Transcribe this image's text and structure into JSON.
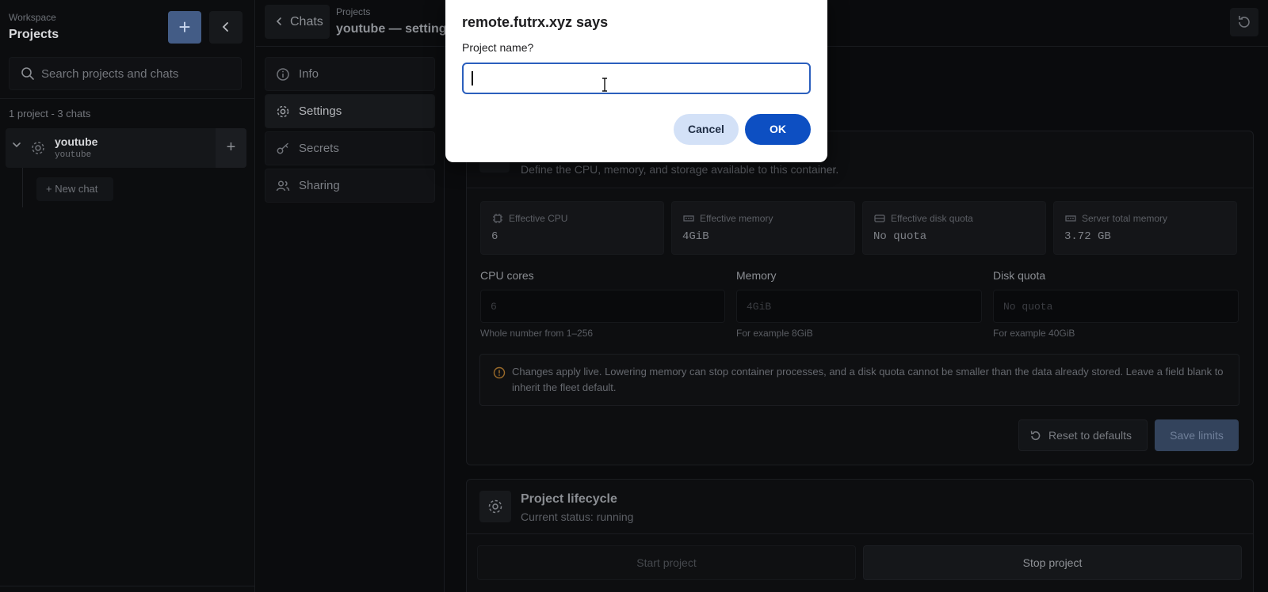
{
  "sidebar": {
    "kicker": "Workspace",
    "title": "Projects",
    "new_button_glyph": "+",
    "collapse_glyph": "‹",
    "search_placeholder": "Search projects and chats",
    "count": "1 project - 3 chats",
    "projects": [
      {
        "name": "youtube",
        "slug": "youtube",
        "add_glyph": "+"
      }
    ],
    "new_chat_label": "+  New chat"
  },
  "breadcrumb": {
    "back_label": "Chats",
    "kicker": "Projects",
    "title": "youtube — settings"
  },
  "nav": {
    "items": [
      {
        "label": "Info",
        "icon": "info-icon"
      },
      {
        "label": "Settings",
        "icon": "gear-icon",
        "active": true
      },
      {
        "label": "Secrets",
        "icon": "key-icon"
      },
      {
        "label": "Sharing",
        "icon": "users-icon"
      }
    ]
  },
  "limits": {
    "subtitle": "Define the CPU, memory, and storage available to this container.",
    "stats": [
      {
        "label": "Effective CPU",
        "value": "6",
        "icon": "cpu-icon"
      },
      {
        "label": "Effective memory",
        "value": "4GiB",
        "icon": "memory-icon"
      },
      {
        "label": "Effective disk quota",
        "value": "No quota",
        "icon": "disk-icon"
      },
      {
        "label": "Server total memory",
        "value": "3.72 GB",
        "icon": "memory-icon"
      }
    ],
    "fields": [
      {
        "label": "CPU cores",
        "placeholder": "6",
        "hint": "Whole number from 1–256"
      },
      {
        "label": "Memory",
        "placeholder": "4GiB",
        "hint": "For example 8GiB"
      },
      {
        "label": "Disk quota",
        "placeholder": "No quota",
        "hint": "For example 40GiB"
      }
    ],
    "notice": "Changes apply live. Lowering memory can stop container processes, and a disk quota cannot be smaller than the data already stored. Leave a field blank to inherit the fleet default.",
    "reset_label": "Reset to defaults",
    "save_label": "Save limits"
  },
  "lifecycle": {
    "title": "Project lifecycle",
    "status": "Current status: running",
    "start_label": "Start project",
    "stop_label": "Stop project"
  },
  "dialog": {
    "title": "remote.futrx.xyz says",
    "prompt": "Project name?",
    "value": "",
    "cancel_label": "Cancel",
    "ok_label": "OK"
  },
  "colors": {
    "accent": "#0d4fc2",
    "new_button": "#435c86",
    "background": "#0a0b0d"
  }
}
